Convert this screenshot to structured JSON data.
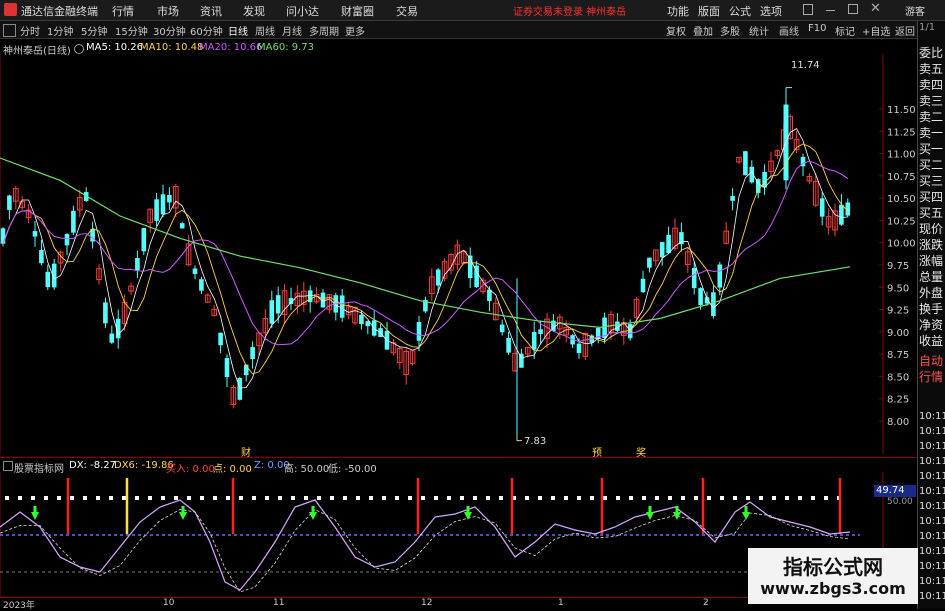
{
  "titlebar": {
    "app_name": "通达信金融终端",
    "menus": [
      "行情",
      "市场",
      "资讯",
      "发现",
      "问小达",
      "财富圈",
      "交易"
    ],
    "warning": "证券交易未登录  神州泰岳",
    "right_menus": [
      "功能",
      "版面",
      "公式",
      "选项"
    ],
    "guest": "游客"
  },
  "toolbar": {
    "periods": [
      "分时",
      "1分钟",
      "5分钟",
      "15分钟",
      "30分钟",
      "60分钟",
      "日线",
      "周线",
      "月线",
      "多周期",
      "更多"
    ],
    "active_period": "日线",
    "right_items": [
      "复权",
      "叠加",
      "多股",
      "统计",
      "画线",
      "F10",
      "标记",
      "+自选",
      "返回"
    ]
  },
  "info": {
    "stock": "神州泰岳(日线)",
    "ma5": "MA5: 10.26",
    "ma10": "MA10: 10.48",
    "ma20": "MA20: 10.66",
    "ma60": "MA60: 9.73",
    "colors": {
      "ma5": "#ffffff",
      "ma10": "#ffd34a",
      "ma20": "#d05cff",
      "ma60": "#70e070"
    }
  },
  "price_axis": [
    "11.50",
    "11.25",
    "11.00",
    "10.75",
    "10.50",
    "10.25",
    "10.00",
    "9.75",
    "9.50",
    "9.25",
    "9.00",
    "8.75",
    "8.50",
    "8.25",
    "8.00"
  ],
  "annotations": {
    "high": "11.74",
    "low": "7.83",
    "marker_cai": "财",
    "marker_yu": "预",
    "marker_jiang": "奖"
  },
  "right_panel": {
    "top_small": "1/1",
    "items": [
      "委比",
      "卖五",
      "卖四",
      "卖三",
      "卖二",
      "卖一",
      "买一",
      "买二",
      "买三",
      "买四",
      "买五",
      "现价",
      "涨跌",
      "涨幅",
      "总量",
      "外盘",
      "换手",
      "净资",
      "收益",
      "自动",
      "行情"
    ],
    "times": [
      "10:11",
      "10:11",
      "10:11",
      "10:11",
      "10:11",
      "10:11",
      "10:11",
      "10:11",
      "10:11",
      "10:11",
      "10:11",
      "10:11",
      "10:11"
    ]
  },
  "indicator": {
    "name": "股票指标网",
    "dx": "DX: -8.27",
    "dx6": "DX6: -19.86",
    "buy": "买入: 0.00",
    "point": "点: 0.00",
    "z": "Z: 0.00",
    "high": "高: 50.00",
    "low": "低: -50.00",
    "value_box": "49.74",
    "axis_right": "50.00"
  },
  "date_axis": [
    "2023年",
    "10",
    "11",
    "12",
    "1",
    "2"
  ],
  "watermark": {
    "line1": "指标公式网",
    "line2": "www.zbgs3.com"
  }
}
